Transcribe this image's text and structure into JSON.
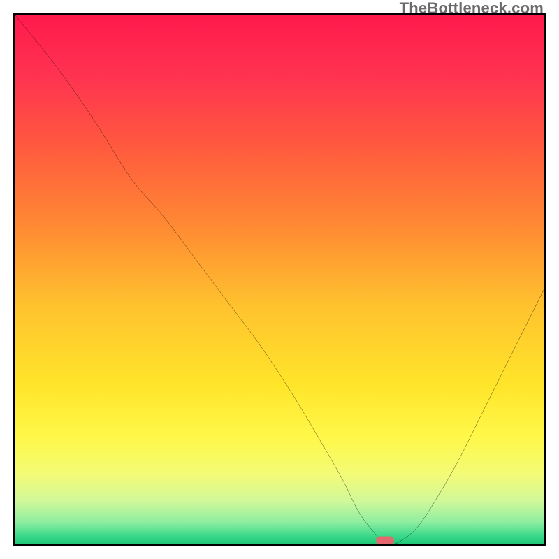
{
  "watermark": "TheBottleneck.com",
  "chart_data": {
    "type": "line",
    "title": "",
    "xlabel": "",
    "ylabel": "",
    "xlim": [
      0,
      100
    ],
    "ylim": [
      0,
      100
    ],
    "grid": false,
    "legend": false,
    "series": [
      {
        "name": "curve",
        "x": [
          0,
          8,
          15,
          22,
          28,
          34,
          40,
          46,
          52,
          58,
          62,
          65,
          68,
          70,
          72,
          76,
          80,
          84,
          88,
          92,
          96,
          100
        ],
        "values": [
          100,
          90,
          80,
          69,
          62,
          54,
          46,
          38,
          29,
          19,
          12,
          6,
          2,
          0,
          0,
          3,
          9,
          16,
          24,
          32,
          40,
          48
        ]
      }
    ],
    "marker": {
      "x": 70,
      "y": 0.5,
      "color": "#e26a6f"
    },
    "background_gradient_stops": [
      {
        "offset": 0.0,
        "color": "#ff1a4d"
      },
      {
        "offset": 0.12,
        "color": "#ff3450"
      },
      {
        "offset": 0.25,
        "color": "#ff5a3e"
      },
      {
        "offset": 0.4,
        "color": "#ff8a33"
      },
      {
        "offset": 0.55,
        "color": "#ffc22e"
      },
      {
        "offset": 0.7,
        "color": "#ffe52a"
      },
      {
        "offset": 0.8,
        "color": "#fff84a"
      },
      {
        "offset": 0.87,
        "color": "#f3fb77"
      },
      {
        "offset": 0.92,
        "color": "#d0f89a"
      },
      {
        "offset": 0.96,
        "color": "#8ceea0"
      },
      {
        "offset": 0.985,
        "color": "#3bd98b"
      },
      {
        "offset": 1.0,
        "color": "#1fc877"
      }
    ]
  }
}
